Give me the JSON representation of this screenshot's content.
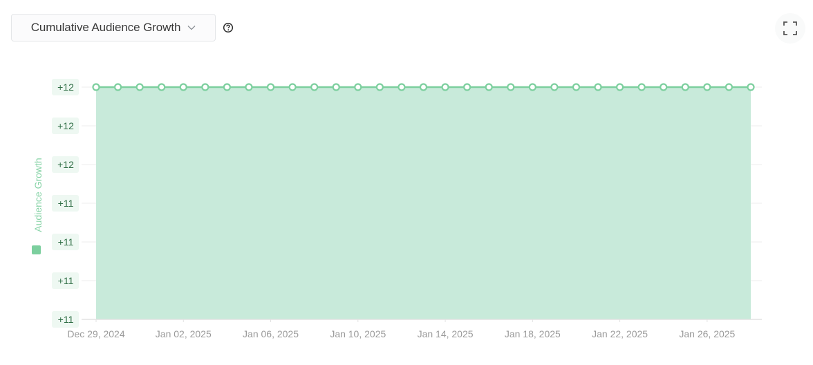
{
  "header": {
    "metric_select_label": "Cumulative Audience Growth",
    "chevron_icon": "chevron-down-icon",
    "help_icon": "question-circle-icon",
    "fullscreen_icon": "fullscreen-icon"
  },
  "colors": {
    "line": "#7ccf9e",
    "area": "#c8eada",
    "tick_bg": "#eef8f2",
    "tick_text": "#2f6e45",
    "axis_text": "#9a9a9a",
    "ylabel": "#86d3a6"
  },
  "chart_data": {
    "type": "area",
    "title": "",
    "xlabel": "",
    "ylabel": "Audience Growth",
    "legend": {
      "entries": [
        "Audience Growth"
      ],
      "placement": "left"
    },
    "grid": true,
    "x": [
      "Dec 29, 2024",
      "Dec 30, 2024",
      "Dec 31, 2024",
      "Jan 01, 2025",
      "Jan 02, 2025",
      "Jan 03, 2025",
      "Jan 04, 2025",
      "Jan 05, 2025",
      "Jan 06, 2025",
      "Jan 07, 2025",
      "Jan 08, 2025",
      "Jan 09, 2025",
      "Jan 10, 2025",
      "Jan 11, 2025",
      "Jan 12, 2025",
      "Jan 13, 2025",
      "Jan 14, 2025",
      "Jan 15, 2025",
      "Jan 16, 2025",
      "Jan 17, 2025",
      "Jan 18, 2025",
      "Jan 19, 2025",
      "Jan 20, 2025",
      "Jan 21, 2025",
      "Jan 22, 2025",
      "Jan 23, 2025",
      "Jan 24, 2025",
      "Jan 25, 2025",
      "Jan 26, 2025",
      "Jan 27, 2025",
      "Jan 28, 2025"
    ],
    "series": [
      {
        "name": "Audience Growth",
        "values": [
          12,
          12,
          12,
          12,
          12,
          12,
          12,
          12,
          12,
          12,
          12,
          12,
          12,
          12,
          12,
          12,
          12,
          12,
          12,
          12,
          12,
          12,
          12,
          12,
          12,
          12,
          12,
          12,
          12,
          12,
          12
        ]
      }
    ],
    "x_tick_labels": [
      "Dec 29, 2024",
      "Jan 02, 2025",
      "Jan 06, 2025",
      "Jan 10, 2025",
      "Jan 14, 2025",
      "Jan 18, 2025",
      "Jan 22, 2025",
      "Jan 26, 2025"
    ],
    "y_tick_labels": [
      "+12",
      "+12",
      "+12",
      "+11",
      "+11",
      "+11",
      "+11"
    ],
    "ylim": [
      11.4,
      12
    ]
  }
}
